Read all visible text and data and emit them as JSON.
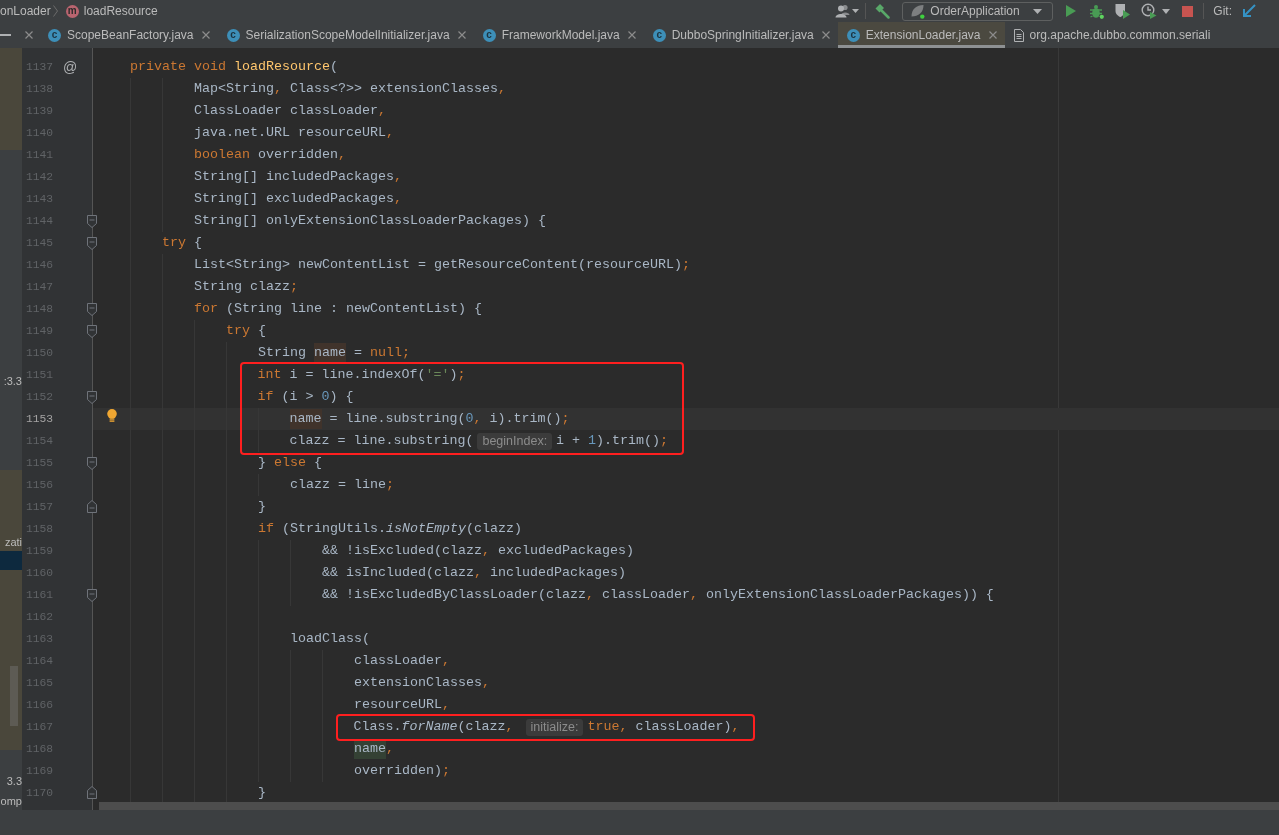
{
  "breadcrumb": [
    {
      "label": "onLoader"
    },
    {
      "label": "loadResource",
      "icon_letter": "m"
    }
  ],
  "toolbar": {
    "run_configuration": "OrderApplication",
    "vcs_label": "Git:"
  },
  "tabs": [
    {
      "label": "ScopeBeanFactory.java",
      "kind": "class",
      "icon_letter": "c",
      "selected": false,
      "closable": true
    },
    {
      "label": "SerializationScopeModelInitializer.java",
      "kind": "class",
      "icon_letter": "c",
      "selected": false,
      "closable": true
    },
    {
      "label": "FrameworkModel.java",
      "kind": "class",
      "icon_letter": "c",
      "selected": false,
      "closable": true
    },
    {
      "label": "DubboSpringInitializer.java",
      "kind": "class",
      "icon_letter": "c",
      "selected": false,
      "closable": true
    },
    {
      "label": "ExtensionLoader.java",
      "kind": "class",
      "icon_letter": "c",
      "selected": true,
      "closable": true
    },
    {
      "label": "org.apache.dubbo.common.seriali",
      "kind": "file",
      "selected": false,
      "closable": false
    }
  ],
  "project_panel": {
    "texts": [
      ":3.3",
      "zati",
      "3.3",
      "omp"
    ]
  },
  "editor": {
    "lines": [
      {
        "number": "1137",
        "current": false,
        "bulb": false,
        "boxed": false,
        "fold_start": false,
        "fold_end": false,
        "gutter_mark": "@",
        "tokens": [
          {
            "kind": "keyword",
            "text": "    private void "
          },
          {
            "kind": "declaration",
            "text": "loadResource"
          },
          {
            "kind": "plain",
            "text": "("
          }
        ]
      },
      {
        "number": "1138",
        "current": false,
        "bulb": false,
        "boxed": false,
        "fold_start": false,
        "fold_end": false,
        "tokens": [
          {
            "kind": "plain",
            "text": "            Map<String"
          },
          {
            "kind": "keyword",
            "text": ", "
          },
          {
            "kind": "plain",
            "text": "Class<?>> extensionClasses"
          },
          {
            "kind": "keyword",
            "text": ","
          }
        ]
      },
      {
        "number": "1139",
        "current": false,
        "bulb": false,
        "boxed": false,
        "fold_start": false,
        "fold_end": false,
        "tokens": [
          {
            "kind": "plain",
            "text": "            ClassLoader classLoader"
          },
          {
            "kind": "keyword",
            "text": ","
          }
        ]
      },
      {
        "number": "1140",
        "current": false,
        "bulb": false,
        "boxed": false,
        "fold_start": false,
        "fold_end": false,
        "tokens": [
          {
            "kind": "plain",
            "text": "            java.net.URL resourceURL"
          },
          {
            "kind": "keyword",
            "text": ","
          }
        ]
      },
      {
        "number": "1141",
        "current": false,
        "bulb": false,
        "boxed": false,
        "fold_start": false,
        "fold_end": false,
        "tokens": [
          {
            "kind": "keyword",
            "text": "            boolean "
          },
          {
            "kind": "plain",
            "text": "overridden"
          },
          {
            "kind": "keyword",
            "text": ","
          }
        ]
      },
      {
        "number": "1142",
        "current": false,
        "bulb": false,
        "boxed": false,
        "fold_start": false,
        "fold_end": false,
        "tokens": [
          {
            "kind": "plain",
            "text": "            String[] includedPackages"
          },
          {
            "kind": "keyword",
            "text": ","
          }
        ]
      },
      {
        "number": "1143",
        "current": false,
        "bulb": false,
        "boxed": false,
        "fold_start": false,
        "fold_end": false,
        "tokens": [
          {
            "kind": "plain",
            "text": "            String[] excludedPackages"
          },
          {
            "kind": "keyword",
            "text": ","
          }
        ]
      },
      {
        "number": "1144",
        "current": false,
        "bulb": false,
        "boxed": false,
        "fold_start": true,
        "fold_end": false,
        "tokens": [
          {
            "kind": "plain",
            "text": "            String[] onlyExtensionClassLoaderPackages) {"
          }
        ]
      },
      {
        "number": "1145",
        "current": false,
        "bulb": false,
        "boxed": false,
        "fold_start": true,
        "fold_end": false,
        "tokens": [
          {
            "kind": "keyword",
            "text": "        try "
          },
          {
            "kind": "plain",
            "text": "{"
          }
        ]
      },
      {
        "number": "1146",
        "current": false,
        "bulb": false,
        "boxed": false,
        "fold_start": false,
        "fold_end": false,
        "tokens": [
          {
            "kind": "plain",
            "text": "            List<String> newContentList = getResourceContent(resourceURL)"
          },
          {
            "kind": "keyword",
            "text": ";"
          }
        ]
      },
      {
        "number": "1147",
        "current": false,
        "bulb": false,
        "boxed": false,
        "fold_start": false,
        "fold_end": false,
        "tokens": [
          {
            "kind": "plain",
            "text": "            String clazz"
          },
          {
            "kind": "keyword",
            "text": ";"
          }
        ]
      },
      {
        "number": "1148",
        "current": false,
        "bulb": false,
        "boxed": false,
        "fold_start": true,
        "fold_end": false,
        "tokens": [
          {
            "kind": "keyword",
            "text": "            for "
          },
          {
            "kind": "plain",
            "text": "(String line : newContentList) {"
          }
        ]
      },
      {
        "number": "1149",
        "current": false,
        "bulb": false,
        "boxed": false,
        "fold_start": true,
        "fold_end": false,
        "tokens": [
          {
            "kind": "keyword",
            "text": "                try "
          },
          {
            "kind": "plain",
            "text": "{"
          }
        ]
      },
      {
        "number": "1150",
        "current": false,
        "bulb": false,
        "boxed": false,
        "fold_start": false,
        "fold_end": false,
        "tokens": [
          {
            "kind": "plain",
            "text": "                    String "
          },
          {
            "kind": "write",
            "text": "name"
          },
          {
            "kind": "plain",
            "text": " = "
          },
          {
            "kind": "keyword",
            "text": "null;"
          }
        ]
      },
      {
        "number": "1151",
        "current": false,
        "bulb": false,
        "boxed": true,
        "fold_start": false,
        "fold_end": false,
        "tokens": [
          {
            "kind": "keyword",
            "text": "                    int "
          },
          {
            "kind": "plain",
            "text": "i = line.indexOf("
          },
          {
            "kind": "string",
            "text": "'='"
          },
          {
            "kind": "plain",
            "text": ")"
          },
          {
            "kind": "keyword",
            "text": ";"
          }
        ]
      },
      {
        "number": "1152",
        "current": false,
        "bulb": false,
        "boxed": true,
        "fold_start": true,
        "fold_end": false,
        "tokens": [
          {
            "kind": "keyword",
            "text": "                    if "
          },
          {
            "kind": "plain",
            "text": "(i > "
          },
          {
            "kind": "number",
            "text": "0"
          },
          {
            "kind": "plain",
            "text": ") {"
          }
        ]
      },
      {
        "number": "1153",
        "current": true,
        "bulb": true,
        "boxed": true,
        "fold_start": false,
        "fold_end": false,
        "tokens": [
          {
            "kind": "write",
            "text": "                        name"
          },
          {
            "kind": "plain",
            "text": " = line.substring("
          },
          {
            "kind": "number",
            "text": "0"
          },
          {
            "kind": "keyword",
            "text": ", "
          },
          {
            "kind": "plain",
            "text": "i).trim()"
          },
          {
            "kind": "keyword",
            "text": ";"
          }
        ]
      },
      {
        "number": "1154",
        "current": false,
        "bulb": false,
        "boxed": true,
        "fold_start": false,
        "fold_end": false,
        "tokens": [
          {
            "kind": "plain",
            "text": "                        clazz = line.substring("
          },
          {
            "kind": "hint",
            "text": "beginIndex:"
          },
          {
            "kind": "plain",
            "text": "i + "
          },
          {
            "kind": "number",
            "text": "1"
          },
          {
            "kind": "plain",
            "text": ").trim()"
          },
          {
            "kind": "keyword",
            "text": ";"
          }
        ]
      },
      {
        "number": "1155",
        "current": false,
        "bulb": false,
        "boxed": false,
        "fold_start": true,
        "fold_end": false,
        "tokens": [
          {
            "kind": "plain",
            "text": "                    } "
          },
          {
            "kind": "keyword",
            "text": "else "
          },
          {
            "kind": "plain",
            "text": "{"
          }
        ]
      },
      {
        "number": "1156",
        "current": false,
        "bulb": false,
        "boxed": false,
        "fold_start": false,
        "fold_end": false,
        "tokens": [
          {
            "kind": "plain",
            "text": "                        clazz = line"
          },
          {
            "kind": "keyword",
            "text": ";"
          }
        ]
      },
      {
        "number": "1157",
        "current": false,
        "bulb": false,
        "boxed": false,
        "fold_start": false,
        "fold_end": true,
        "tokens": [
          {
            "kind": "plain",
            "text": "                    }"
          }
        ]
      },
      {
        "number": "1158",
        "current": false,
        "bulb": false,
        "boxed": false,
        "fold_start": false,
        "fold_end": false,
        "tokens": [
          {
            "kind": "keyword",
            "text": "                    if "
          },
          {
            "kind": "plain",
            "text": "(StringUtils."
          },
          {
            "kind": "static",
            "text": "isNotEmpty"
          },
          {
            "kind": "plain",
            "text": "(clazz)"
          }
        ]
      },
      {
        "number": "1159",
        "current": false,
        "bulb": false,
        "boxed": false,
        "fold_start": false,
        "fold_end": false,
        "tokens": [
          {
            "kind": "plain",
            "text": "                            && !isExcluded(clazz"
          },
          {
            "kind": "keyword",
            "text": ", "
          },
          {
            "kind": "plain",
            "text": "excludedPackages)"
          }
        ]
      },
      {
        "number": "1160",
        "current": false,
        "bulb": false,
        "boxed": false,
        "fold_start": false,
        "fold_end": false,
        "tokens": [
          {
            "kind": "plain",
            "text": "                            && isIncluded(clazz"
          },
          {
            "kind": "keyword",
            "text": ", "
          },
          {
            "kind": "plain",
            "text": "includedPackages)"
          }
        ]
      },
      {
        "number": "1161",
        "current": false,
        "bulb": false,
        "boxed": false,
        "fold_start": true,
        "fold_end": false,
        "tokens": [
          {
            "kind": "plain",
            "text": "                            && !isExcludedByClassLoader(clazz"
          },
          {
            "kind": "keyword",
            "text": ", "
          },
          {
            "kind": "plain",
            "text": "classLoader"
          },
          {
            "kind": "keyword",
            "text": ", "
          },
          {
            "kind": "plain",
            "text": "onlyExtensionClassLoaderPackages)) {"
          }
        ]
      },
      {
        "number": "1162",
        "current": false,
        "bulb": false,
        "boxed": false,
        "fold_start": false,
        "fold_end": false
      },
      {
        "number": "1163",
        "current": false,
        "bulb": false,
        "boxed": false,
        "fold_start": false,
        "fold_end": false,
        "tokens": [
          {
            "kind": "plain",
            "text": "                        loadClass("
          }
        ]
      },
      {
        "number": "1164",
        "current": false,
        "bulb": false,
        "boxed": false,
        "fold_start": false,
        "fold_end": false,
        "tokens": [
          {
            "kind": "plain",
            "text": "                                classLoader"
          },
          {
            "kind": "keyword",
            "text": ","
          }
        ]
      },
      {
        "number": "1165",
        "current": false,
        "bulb": false,
        "boxed": false,
        "fold_start": false,
        "fold_end": false,
        "tokens": [
          {
            "kind": "plain",
            "text": "                                extensionClasses"
          },
          {
            "kind": "keyword",
            "text": ","
          }
        ]
      },
      {
        "number": "1166",
        "current": false,
        "bulb": false,
        "boxed": false,
        "fold_start": false,
        "fold_end": false,
        "tokens": [
          {
            "kind": "plain",
            "text": "                                resourceURL"
          },
          {
            "kind": "keyword",
            "text": ","
          }
        ]
      },
      {
        "number": "1167",
        "current": false,
        "bulb": false,
        "boxed": true,
        "fold_start": false,
        "fold_end": false,
        "tokens": [
          {
            "kind": "plain",
            "text": "                                Class."
          },
          {
            "kind": "static",
            "text": "forName"
          },
          {
            "kind": "plain",
            "text": "(clazz"
          },
          {
            "kind": "keyword",
            "text": ", "
          },
          {
            "kind": "hint",
            "text": "initialize:"
          },
          {
            "kind": "keyword",
            "text": "true, "
          },
          {
            "kind": "plain",
            "text": "classLoader)"
          },
          {
            "kind": "keyword",
            "text": ","
          }
        ]
      },
      {
        "number": "1168",
        "current": false,
        "bulb": false,
        "boxed": false,
        "fold_start": false,
        "fold_end": false,
        "tokens": [
          {
            "kind": "read",
            "text": "                                name"
          },
          {
            "kind": "keyword",
            "text": ","
          }
        ]
      },
      {
        "number": "1169",
        "current": false,
        "bulb": false,
        "boxed": false,
        "fold_start": false,
        "fold_end": false,
        "tokens": [
          {
            "kind": "plain",
            "text": "                                overridden)"
          },
          {
            "kind": "keyword",
            "text": ";"
          }
        ]
      },
      {
        "number": "1170",
        "current": false,
        "bulb": false,
        "boxed": false,
        "fold_start": false,
        "fold_end": true,
        "tokens": [
          {
            "kind": "plain",
            "text": "                    }"
          }
        ]
      }
    ]
  }
}
